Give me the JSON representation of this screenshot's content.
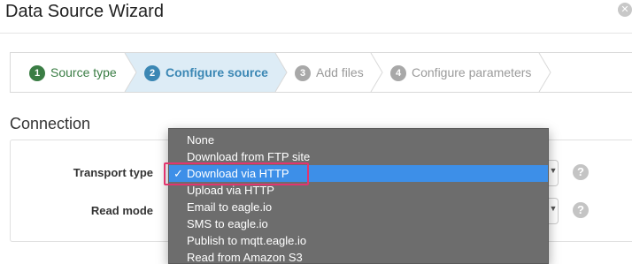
{
  "window": {
    "title": "Data Source Wizard",
    "close_glyph": "✕"
  },
  "wizard": {
    "steps": [
      {
        "number": "1",
        "label": "Source type",
        "state": "complete"
      },
      {
        "number": "2",
        "label": "Configure source",
        "state": "active"
      },
      {
        "number": "3",
        "label": "Add files",
        "state": "pending"
      },
      {
        "number": "4",
        "label": "Configure parameters",
        "state": "pending"
      }
    ]
  },
  "connection": {
    "section_title": "Connection",
    "transport_type_label": "Transport type",
    "read_mode_label": "Read mode",
    "help_glyph": "?",
    "select_arrows": "▲▼"
  },
  "dropdown": {
    "selected_index": 2,
    "check_glyph": "✓",
    "options": [
      "None",
      "Download from FTP site",
      "Download via HTTP",
      "Upload via HTTP",
      "Email to eagle.io",
      "SMS to eagle.io",
      "Publish to mqtt.eagle.io",
      "Read from Amazon S3"
    ]
  },
  "colors": {
    "step_complete": "#3a7d44",
    "step_active": "#3b87b4",
    "step_active_bg": "#ddecf6",
    "step_pending": "#9a9a9a",
    "dropdown_bg": "#6d6d6d",
    "dropdown_selected": "#3d8fe8",
    "highlight": "#e2356f"
  }
}
